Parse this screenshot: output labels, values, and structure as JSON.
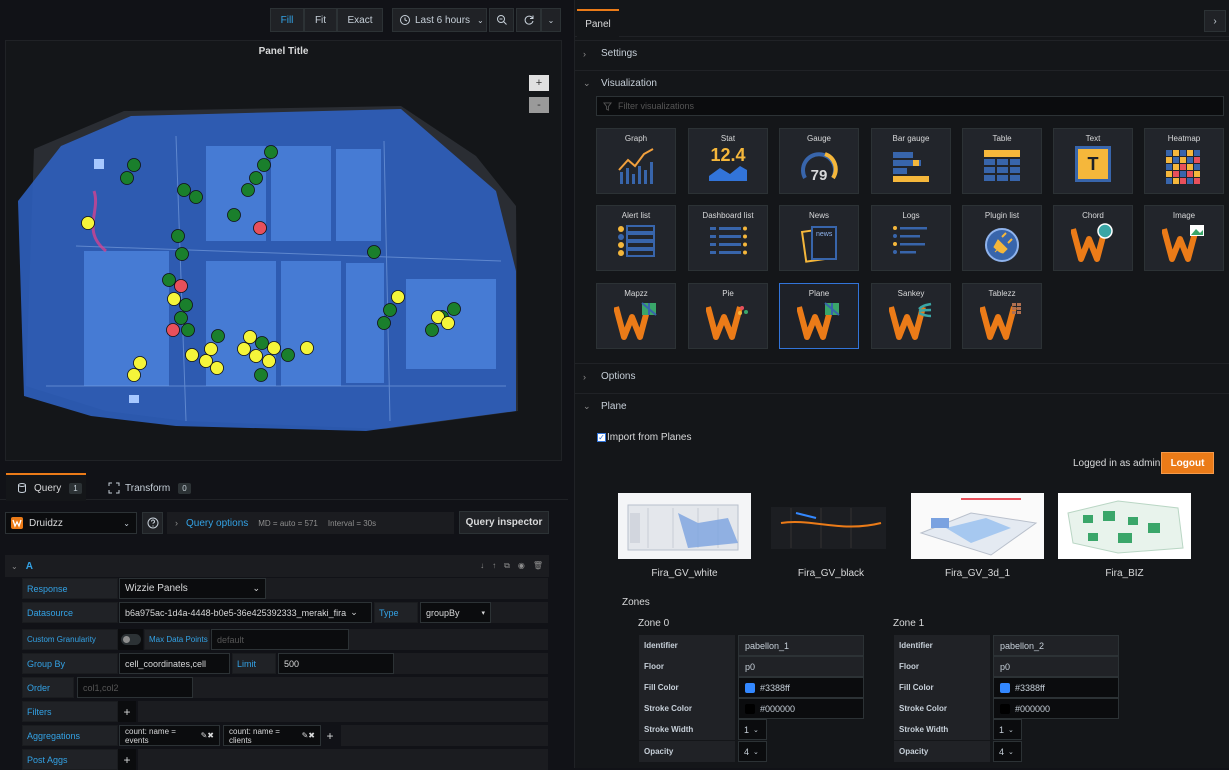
{
  "toolbar": {
    "fill": "Fill",
    "fit": "Fit",
    "exact": "Exact",
    "time_range": "Last 6 hours"
  },
  "panel": {
    "title": "Panel Title",
    "zoom_in": "+",
    "zoom_out": "-"
  },
  "query_tabs": {
    "query_label": "Query",
    "query_count": "1",
    "transform_label": "Transform",
    "transform_count": "0"
  },
  "datasource": {
    "name": "Druidzz",
    "query_options": "Query options",
    "md": "MD = auto = 571",
    "interval": "Interval = 30s",
    "inspector": "Query inspector"
  },
  "query": {
    "ref": "A",
    "response_label": "Response",
    "response_value": "Wizzie Panels",
    "datasource_label": "Datasource",
    "datasource_value": "b6a975ac-1d4a-4448-b0e5-36e425392333_meraki_fira",
    "type_label": "Type",
    "type_value": "groupBy",
    "granularity_label": "Custom Granularity",
    "max_points_label": "Max Data Points",
    "max_points_placeholder": "default",
    "group_by_label": "Group By",
    "group_by_value": "cell_coordinates,cell",
    "limit_label": "Limit",
    "limit_value": "500",
    "order_label": "Order",
    "order_placeholder": "col1,col2",
    "filters_label": "Filters",
    "aggregations_label": "Aggregations",
    "agg1": "count: name = events",
    "agg2": "count: name = clients",
    "post_aggs_label": "Post Aggs",
    "add": "+"
  },
  "right": {
    "tab": "Panel",
    "settings": "Settings",
    "visualization": "Visualization",
    "filter_placeholder": "Filter visualizations",
    "options": "Options",
    "plane": "Plane",
    "import_label": "Import from Planes",
    "logged_in": "Logged in as admin",
    "logout": "Logout",
    "zones_title": "Zones"
  },
  "visualizations": [
    {
      "label": "Graph"
    },
    {
      "label": "Stat",
      "value": "12.4"
    },
    {
      "label": "Gauge",
      "value": "79"
    },
    {
      "label": "Bar gauge"
    },
    {
      "label": "Table"
    },
    {
      "label": "Text",
      "glyph": "T"
    },
    {
      "label": "Heatmap"
    },
    {
      "label": "Alert list"
    },
    {
      "label": "Dashboard list"
    },
    {
      "label": "News",
      "glyph": "news"
    },
    {
      "label": "Logs"
    },
    {
      "label": "Plugin list"
    },
    {
      "label": "Chord"
    },
    {
      "label": "Image"
    },
    {
      "label": "Mapzz"
    },
    {
      "label": "Pie"
    },
    {
      "label": "Plane"
    },
    {
      "label": "Sankey"
    },
    {
      "label": "Tablezz"
    }
  ],
  "planes": [
    {
      "name": "Fira_GV_white"
    },
    {
      "name": "Fira_GV_black"
    },
    {
      "name": "Fira_GV_3d_1"
    },
    {
      "name": "Fira_BIZ"
    }
  ],
  "zones": [
    {
      "title": "Zone 0",
      "identifier_label": "Identifier",
      "identifier": "pabellon_1",
      "floor_label": "Floor",
      "floor": "p0",
      "fill_label": "Fill Color",
      "fill": "#3388ff",
      "stroke_label": "Stroke Color",
      "stroke": "#000000",
      "stroke_width_label": "Stroke Width",
      "stroke_width": "1",
      "opacity_label": "Opacity",
      "opacity": "4"
    },
    {
      "title": "Zone 1",
      "identifier_label": "Identifier",
      "identifier": "pabellon_2",
      "floor_label": "Floor",
      "floor": "p0",
      "fill_label": "Fill Color",
      "fill": "#3388ff",
      "stroke_label": "Stroke Color",
      "stroke": "#000000",
      "stroke_width_label": "Stroke Width",
      "stroke_width": "1",
      "opacity_label": "Opacity",
      "opacity": "4"
    }
  ],
  "colors": {
    "accent_blue": "#33a2e5",
    "selected_border": "#3274d9",
    "logout_orange": "#eb7b18",
    "zone_fill": "#3388ff",
    "marker_green": "#1a7f2c",
    "marker_yellow": "#f5f53a",
    "marker_red": "#e8505b"
  }
}
